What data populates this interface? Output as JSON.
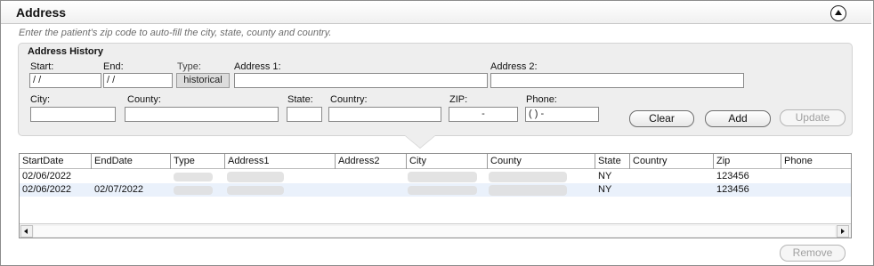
{
  "section": {
    "title": "Address"
  },
  "hint": "Enter the patient's zip code to auto-fill the city, state, county and country.",
  "panel": {
    "title": "Address History",
    "fields": {
      "start": {
        "label": "Start:",
        "value": " / /"
      },
      "end": {
        "label": "End:",
        "value": " / /"
      },
      "type": {
        "label": "Type:",
        "value": "historical"
      },
      "address1": {
        "label": "Address 1:",
        "value": ""
      },
      "address2": {
        "label": "Address 2:",
        "value": ""
      },
      "city": {
        "label": "City:",
        "value": ""
      },
      "county": {
        "label": "County:",
        "value": ""
      },
      "state": {
        "label": "State:",
        "value": ""
      },
      "country": {
        "label": "Country:",
        "value": ""
      },
      "zip": {
        "label": "ZIP:",
        "value": "-"
      },
      "phone": {
        "label": "Phone:",
        "value": "(  )  -"
      }
    },
    "buttons": {
      "clear": "Clear",
      "add": "Add",
      "update": "Update"
    }
  },
  "table": {
    "columns": [
      "StartDate",
      "EndDate",
      "Type",
      "Address1",
      "Address2",
      "City",
      "County",
      "State",
      "Country",
      "Zip",
      "Phone"
    ],
    "rows": [
      {
        "start_date": "02/06/2022",
        "end_date": "",
        "state": "NY",
        "zip": "123456"
      },
      {
        "start_date": "02/06/2022",
        "end_date": "02/07/2022",
        "state": "NY",
        "zip": "123456"
      }
    ]
  },
  "remove_button": "Remove"
}
